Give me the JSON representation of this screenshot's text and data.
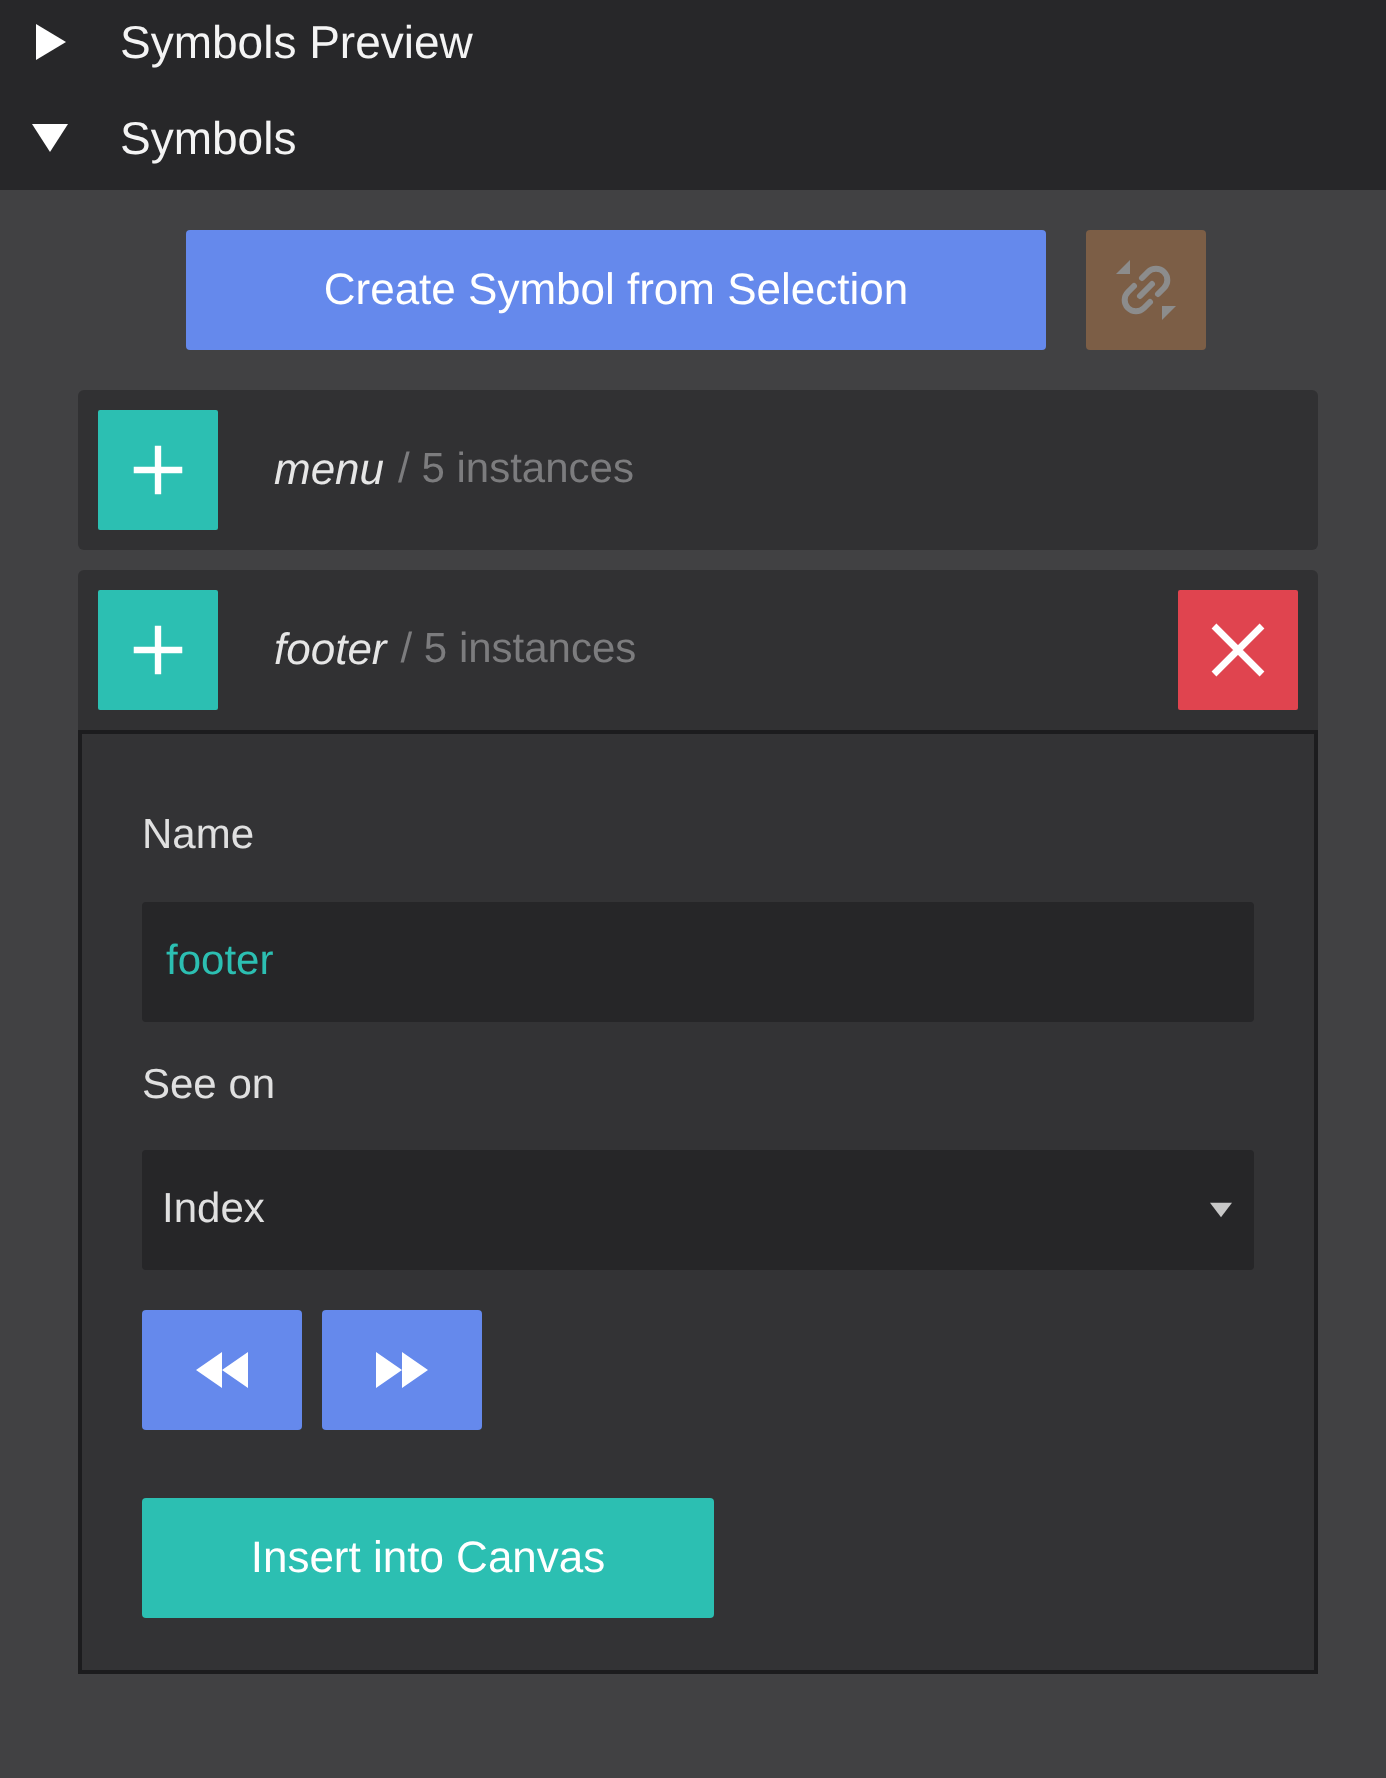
{
  "sections": [
    {
      "title": "Symbols Preview",
      "expanded": false
    },
    {
      "title": "Symbols",
      "expanded": true
    }
  ],
  "create_button": {
    "label": "Create Symbol from Selection"
  },
  "link_button": {
    "disabled": true
  },
  "symbols": [
    {
      "name": "menu",
      "count": "/ 5 instances",
      "expanded": false
    },
    {
      "name": "footer",
      "count": "/ 5 instances",
      "expanded": true,
      "editor": {
        "name_field": {
          "label": "Name",
          "value": "footer"
        },
        "see_on": {
          "label": "See on",
          "value": "Index"
        },
        "insert_button": {
          "label": "Insert into Canvas"
        }
      }
    }
  ]
}
